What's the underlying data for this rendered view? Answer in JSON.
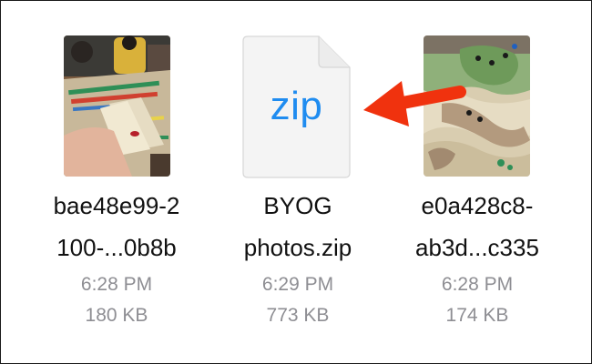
{
  "files": [
    {
      "name_line1": "bae48e99-2",
      "name_line2": "100-...0b8b",
      "time": "6:28 PM",
      "size": "180 KB",
      "thumbnail": "photo-board-game-cards"
    },
    {
      "name_line1": "BYOG",
      "name_line2": "photos.zip",
      "time": "6:29 PM",
      "size": "773 KB",
      "icon_text": "zip"
    },
    {
      "name_line1": "e0a428c8-",
      "name_line2": "ab3d...c335",
      "time": "6:28 PM",
      "size": "174 KB",
      "thumbnail": "photo-map-board-game"
    }
  ],
  "colors": {
    "accent_zip": "#1f8cf0",
    "arrow": "#f0320e",
    "secondary_text": "#8e8e93"
  }
}
